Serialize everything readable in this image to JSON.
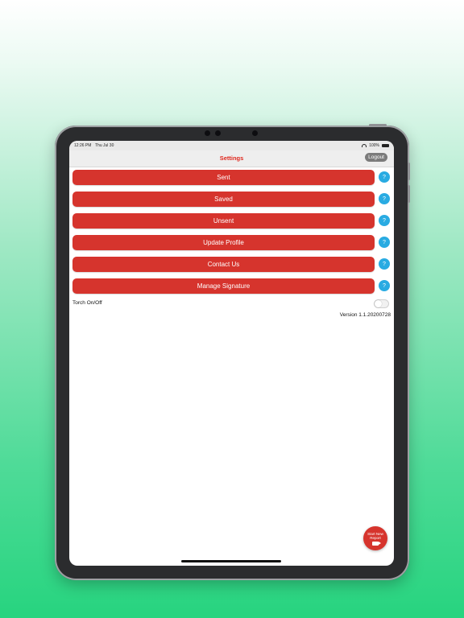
{
  "status": {
    "time": "12:26 PM",
    "date": "Thu Jul 30",
    "battery": "100%"
  },
  "nav": {
    "title": "Settings",
    "logout_label": "Logout"
  },
  "menu": [
    {
      "label": "Sent",
      "help": "?"
    },
    {
      "label": "Saved",
      "help": "?"
    },
    {
      "label": "Unsent",
      "help": "?"
    },
    {
      "label": "Update Profile",
      "help": "?"
    },
    {
      "label": "Contact Us",
      "help": "?"
    },
    {
      "label": "Manage Signature",
      "help": "?"
    }
  ],
  "torch": {
    "label": "Torch On/Off",
    "enabled": false
  },
  "version": "Version 1.1.20200728",
  "fab": {
    "label": "Start New Report",
    "icon": "video-camera-icon"
  },
  "colors": {
    "accent_red": "#d6342d",
    "title_red": "#e0281e",
    "help_blue": "#29abe2",
    "background_green": "#27d47f"
  }
}
